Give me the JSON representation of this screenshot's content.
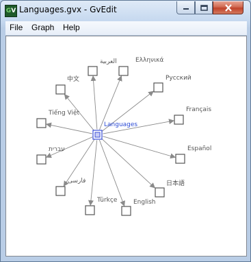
{
  "window": {
    "title": "Languages.gvx - GvEdit",
    "icon": "gvedit-app-icon",
    "icon_text_g": "G",
    "icon_text_v": "V"
  },
  "menu": {
    "items": [
      "File",
      "Graph",
      "Help"
    ]
  },
  "graph": {
    "center_label": "Languages",
    "nodes": [
      "العربية",
      "Ελληνικά",
      "中文",
      "Русский",
      "Tiếng Việt",
      "Français",
      "עברית",
      "Español",
      "فارسی",
      "日本語",
      "Türkçe",
      "English"
    ]
  },
  "colors": {
    "edge": "#8a8a8a",
    "node_border": "#555555",
    "center_border": "#3b4fd8",
    "center_label": "#2b4bd6"
  }
}
